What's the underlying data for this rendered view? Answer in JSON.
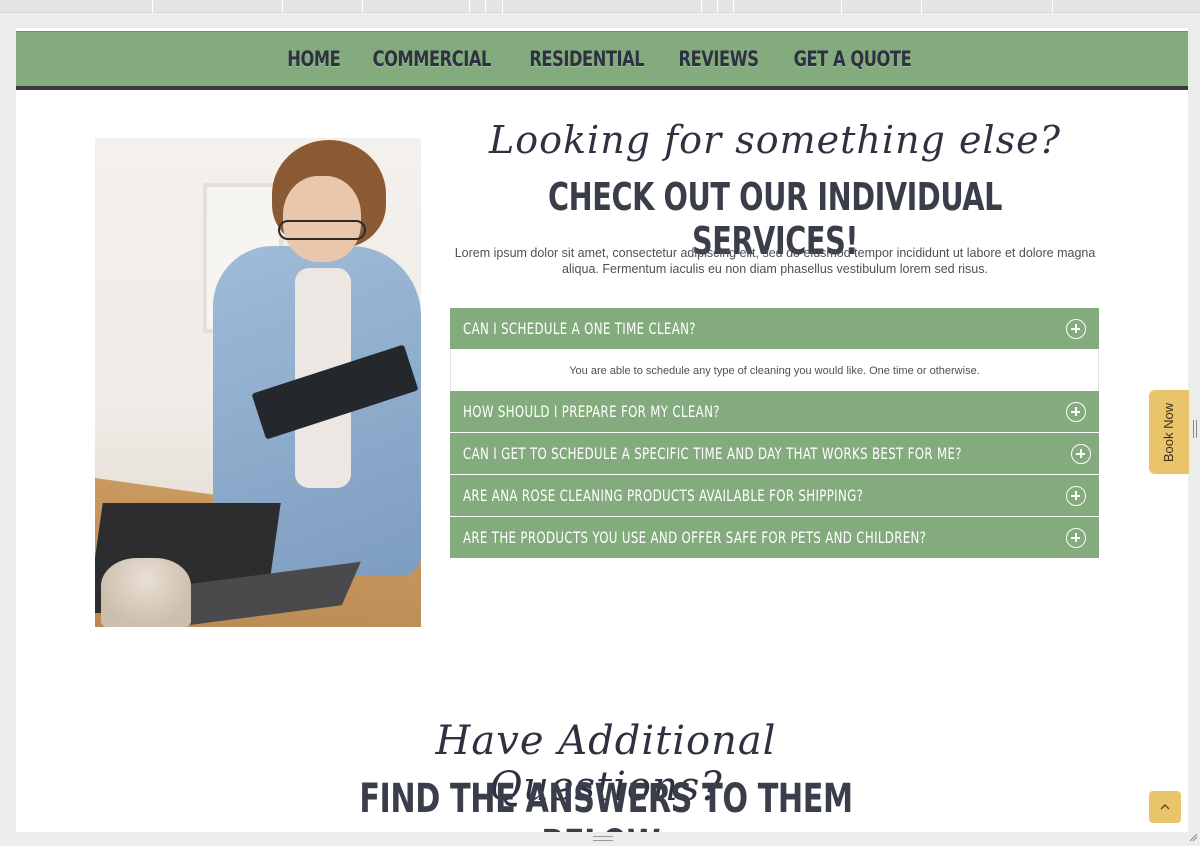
{
  "nav": {
    "items": [
      "HOME",
      "COMMERCIAL",
      "RESIDENTIAL",
      "REVIEWS",
      "GET A QUOTE"
    ]
  },
  "services": {
    "script_heading": "Looking for something else?",
    "heading": "CHECK OUT OUR INDIVIDUAL SERVICES!",
    "intro": "Lorem ipsum dolor sit amet, consectetur adipiscing elit, sed do eiusmod tempor incididunt ut labore et dolore magna aliqua. Fermentum iaculis eu non diam phasellus vestibulum lorem sed risus."
  },
  "faq": [
    {
      "question": "CAN I SCHEDULE A ONE TIME CLEAN?",
      "answer": "You are able to schedule any type of cleaning you would like. One time or otherwise.",
      "expanded": true
    },
    {
      "question": "HOW SHOULD I PREPARE FOR MY CLEAN?",
      "expanded": false
    },
    {
      "question": "CAN I GET TO SCHEDULE A SPECIFIC TIME AND DAY THAT WORKS BEST FOR ME?",
      "expanded": false
    },
    {
      "question": "ARE ANA ROSE CLEANING PRODUCTS AVAILABLE FOR SHIPPING?",
      "expanded": false
    },
    {
      "question": "ARE THE PRODUCTS YOU USE AND OFFER SAFE FOR PETS AND CHILDREN?",
      "expanded": false
    }
  ],
  "questions": {
    "script_heading": "Have Additional Questions?",
    "heading": "FIND THE ANSWERS TO THEM BELOW:"
  },
  "book_now": {
    "label": "Book Now"
  },
  "icons": {
    "faq_toggle": "plus-circle-icon",
    "scroll_top": "chevron-up-icon"
  },
  "colors": {
    "nav_green": "#84ab7d",
    "accent_yellow": "#e9c46a",
    "heading_dark": "#3a3e4a"
  }
}
